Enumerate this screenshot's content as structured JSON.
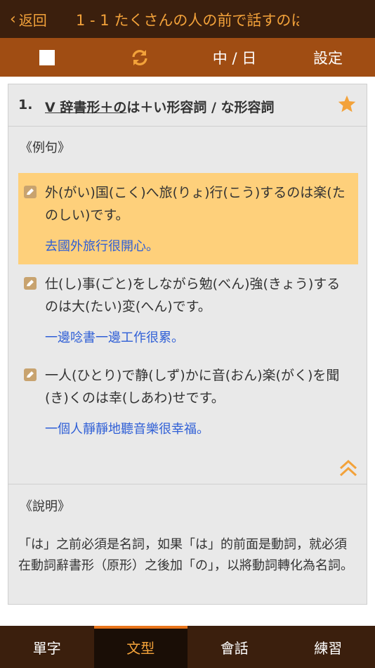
{
  "header": {
    "back_label": "返回",
    "title": "1 - 1 たくさんの人の前で話すのは"
  },
  "toolbar": {
    "language_toggle": "中 / 日",
    "settings_label": "設定"
  },
  "grammar": {
    "number": "1.",
    "pattern_underlined": "V 辞書形＋の",
    "pattern_rest": "は＋い形容詞 / な形容詞",
    "examples_label": "《例句》",
    "examples": [
      {
        "japanese": "外(がい)国(こく)へ旅(りょ)行(こう)するのは楽(たのしい)です。",
        "translation": "去國外旅行很開心。",
        "highlighted": true
      },
      {
        "japanese": "仕(し)事(ごと)をしながら勉(べん)強(きょう)するのは大(たい)変(へん)です。",
        "translation": "一邊唸書一邊工作很累。",
        "highlighted": false
      },
      {
        "japanese": "一人(ひとり)で静(しず)かに音(おん)楽(がく)を聞(き)くのは幸(しあわ)せです。",
        "translation": "一個人靜靜地聽音樂很幸福。",
        "highlighted": false
      }
    ],
    "explanation_label": "《說明》",
    "explanation": "「は」之前必須是名詞，如果「は」的前面是動詞，就必須在動詞辭書形（原形）之後加「の」，以將動詞轉化為名詞。"
  },
  "tabs": [
    {
      "label": "單字",
      "active": false
    },
    {
      "label": "文型",
      "active": true
    },
    {
      "label": "會話",
      "active": false
    },
    {
      "label": "練習",
      "active": false
    }
  ],
  "colors": {
    "header_bg": "#3b1f0d",
    "toolbar_bg": "#a04d13",
    "accent": "#f3a23a",
    "highlight": "#fed07b",
    "translation": "#2f5fd6"
  }
}
